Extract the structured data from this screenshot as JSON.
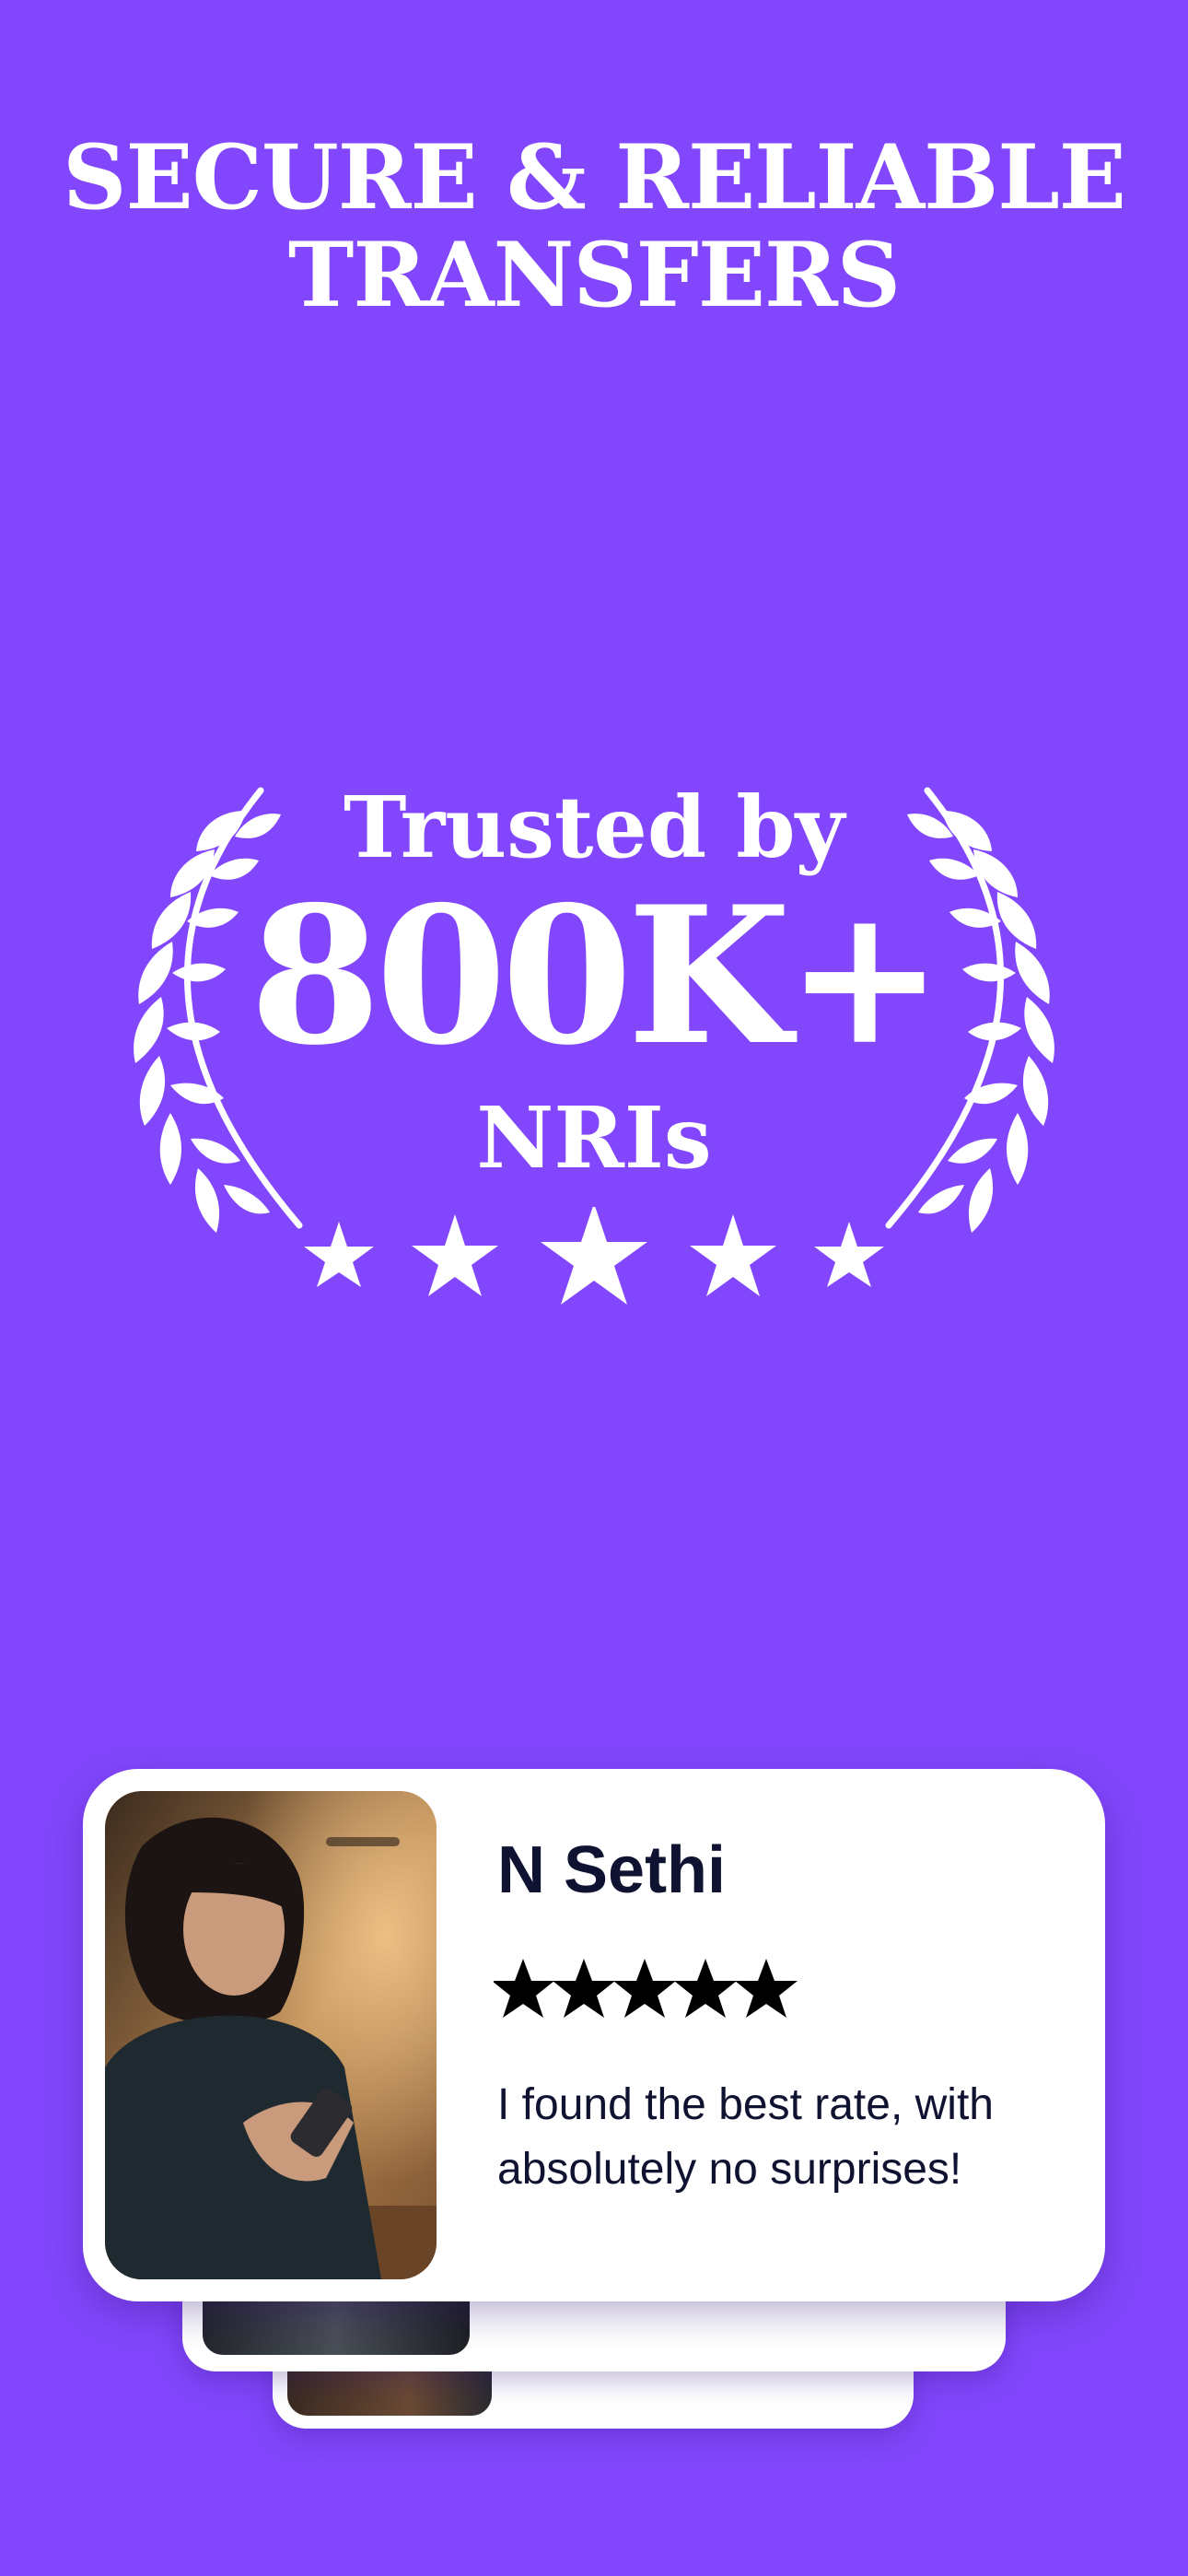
{
  "headline": {
    "line1": "SECURE & RELIABLE",
    "line2": "TRANSFERS"
  },
  "badge": {
    "prefix": "Trusted by",
    "number": "800K+",
    "suffix": "NRIs",
    "stars": 5
  },
  "review": {
    "name": "N Sethi",
    "rating": 5,
    "text_line1": "I found the best rate, with",
    "text_line2": "absolutely no surprises!"
  },
  "colors": {
    "background": "#8247FC",
    "card": "#FFFFFF",
    "text_dark": "#0F1230",
    "accent_white": "#FFFFFF"
  },
  "icons": {
    "laurel": "laurel-wreath-icon",
    "star": "star-icon"
  }
}
